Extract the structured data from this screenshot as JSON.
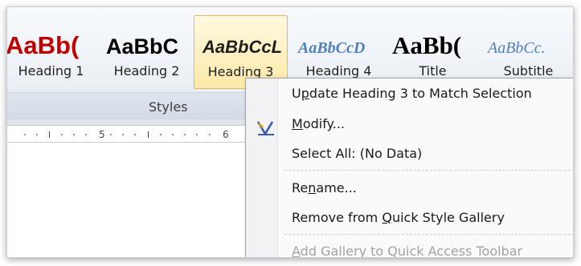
{
  "styles_gallery": {
    "group_label": "Styles",
    "items": [
      {
        "preview": "AaBb(",
        "label": "Heading 1"
      },
      {
        "preview": "AaBbC",
        "label": "Heading 2"
      },
      {
        "preview": "AaBbCcL",
        "label": "Heading 3",
        "selected": true
      },
      {
        "preview": "AaBbCcD",
        "label": "Heading 4"
      },
      {
        "preview": "AaBb(",
        "label": "Title"
      },
      {
        "preview": "AaBbCc.",
        "label": "Subtitle"
      }
    ]
  },
  "ruler": {
    "labels": [
      "5",
      "6"
    ]
  },
  "context_menu": {
    "items": [
      {
        "pre": "U",
        "key": "p",
        "post": "date Heading 3 to Match Selection"
      },
      {
        "pre": "",
        "key": "M",
        "post": "odify..."
      },
      {
        "pre": "Select All: (No Data)",
        "key": "",
        "post": ""
      },
      {
        "pre": "Re",
        "key": "n",
        "post": "ame..."
      },
      {
        "pre": "Remove from ",
        "key": "Q",
        "post": "uick Style Gallery"
      },
      {
        "pre": "",
        "key": "A",
        "post": "dd Gallery to Quick Access Toolbar"
      }
    ]
  },
  "colors": {
    "heading1": "#c00000",
    "heading4": "#4f81bd",
    "selected_border": "#e7b857"
  }
}
